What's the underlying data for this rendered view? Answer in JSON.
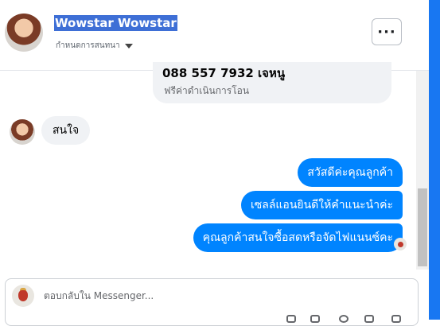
{
  "header": {
    "title": "Wowstar Wowstar",
    "subtitle": "กำหนดการสนทนา",
    "more_label": "···"
  },
  "previous_message": {
    "line1": "088 557 7932 เจหนู",
    "line2": "ฟรีค่าดำเนินการโอน"
  },
  "incoming": [
    {
      "text": "สนใจ"
    }
  ],
  "outgoing": [
    {
      "text": "สวัสดีค่ะคุณลูกค้า"
    },
    {
      "text": "เซลล์แอนยินดีให้คำแนะนำค่ะ"
    },
    {
      "text": "คุณลูกค้าสนใจซื้อสดหรือจัดไฟแนนซ์คะ"
    }
  ],
  "composer": {
    "placeholder": "ตอบกลับใน Messenger..."
  },
  "colors": {
    "accent": "#0084ff",
    "edge": "#1877f2",
    "incoming_bg": "#f0f2f5",
    "title_highlight": "#3e6fd6"
  },
  "icons": [
    "more-dots-icon",
    "caret-down-icon",
    "seen-avatar-icon",
    "composer-avatar-icon"
  ]
}
